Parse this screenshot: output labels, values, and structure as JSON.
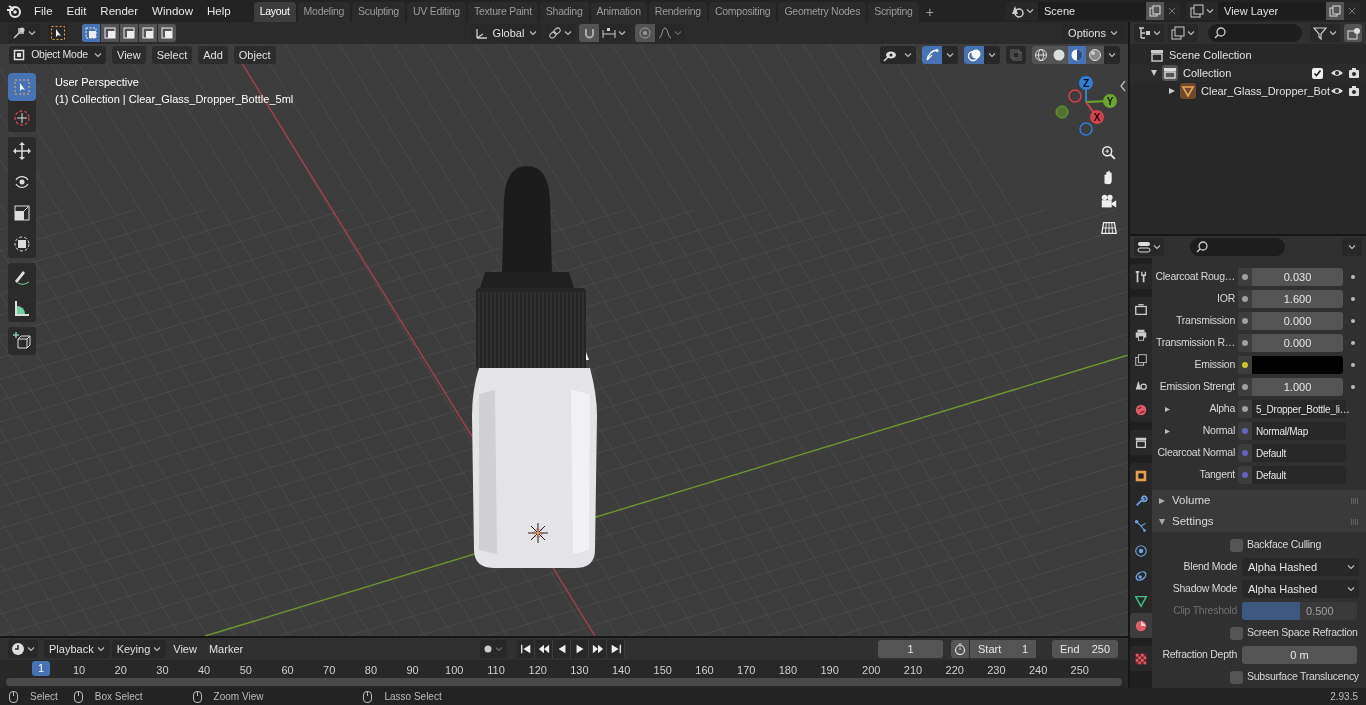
{
  "menu": [
    "File",
    "Edit",
    "Render",
    "Window",
    "Help"
  ],
  "workspaces": [
    {
      "label": "Layout",
      "selected": true
    },
    {
      "label": "Modeling",
      "selected": false
    },
    {
      "label": "Sculpting",
      "selected": false
    },
    {
      "label": "UV Editing",
      "selected": false
    },
    {
      "label": "Texture Paint",
      "selected": false
    },
    {
      "label": "Shading",
      "selected": false
    },
    {
      "label": "Animation",
      "selected": false
    },
    {
      "label": "Rendering",
      "selected": false
    },
    {
      "label": "Compositing",
      "selected": false
    },
    {
      "label": "Geometry Nodes",
      "selected": false
    },
    {
      "label": "Scripting",
      "selected": false
    }
  ],
  "add_workspace": "+",
  "scene": "Scene",
  "view_layer": "View Layer",
  "select_modes": [
    {
      "selected": true
    },
    {
      "selected": false
    },
    {
      "selected": false
    },
    {
      "selected": false
    },
    {
      "selected": false
    }
  ],
  "orientation": "Global",
  "options": "Options",
  "mode": "Object Mode",
  "viewport_menus": [
    "View",
    "Select",
    "Add",
    "Object"
  ],
  "viewport_toggles": {
    "gizmos": true,
    "overlays": true
  },
  "shading": [
    {
      "kind": "wireframe",
      "selected": false
    },
    {
      "kind": "solid",
      "selected": false
    },
    {
      "kind": "material",
      "selected": true
    },
    {
      "kind": "rendered",
      "selected": false
    }
  ],
  "viewport": {
    "perspective": "User Perspective",
    "object_info": "(1) Collection | Clear_Glass_Dropper_Bottle_5ml",
    "gizmo_axes": [
      "Z",
      "Y",
      "X"
    ]
  },
  "tool_groups": [
    [
      {
        "kind": "select",
        "selected": true
      },
      {
        "kind": "cursor",
        "selected": false
      }
    ],
    [
      {
        "kind": "move",
        "selected": false
      },
      {
        "kind": "rotate",
        "selected": false
      },
      {
        "kind": "scale",
        "selected": false
      },
      {
        "kind": "transform",
        "selected": false
      }
    ],
    [
      {
        "kind": "annotate",
        "selected": false
      },
      {
        "kind": "measure",
        "selected": false
      }
    ],
    [
      {
        "kind": "add_cube",
        "selected": false
      }
    ]
  ],
  "outliner": {
    "root": "Scene Collection",
    "items": [
      {
        "label": "Collection",
        "kind": "collection",
        "expanded": true,
        "checked": true,
        "children": [
          {
            "label": "Clear_Glass_Dropper_Bot",
            "kind": "mesh",
            "expanded": false
          }
        ]
      }
    ]
  },
  "property_tab_groups": [
    [
      {
        "kind": "tool",
        "selected": false
      }
    ],
    [
      {
        "kind": "render",
        "selected": false
      },
      {
        "kind": "output",
        "selected": false
      },
      {
        "kind": "view_layer",
        "selected": false
      },
      {
        "kind": "scene",
        "selected": false
      },
      {
        "kind": "world",
        "selected": false
      }
    ],
    [
      {
        "kind": "collection",
        "selected": false
      }
    ],
    [
      {
        "kind": "object",
        "selected": false
      },
      {
        "kind": "modifier",
        "selected": false
      },
      {
        "kind": "particles",
        "selected": false
      },
      {
        "kind": "physics",
        "selected": false
      },
      {
        "kind": "constraints",
        "selected": false
      },
      {
        "kind": "data",
        "selected": false
      },
      {
        "kind": "material",
        "selected": true
      }
    ],
    [
      {
        "kind": "texture",
        "selected": false
      }
    ]
  ],
  "properties": [
    {
      "kind": "value",
      "label": "Clearcoat Roug…",
      "value": "0.030",
      "socket": {
        "color": "#a1a1a1"
      }
    },
    {
      "kind": "value",
      "label": "IOR",
      "value": "1.600",
      "socket": {
        "color": "#a1a1a1"
      }
    },
    {
      "kind": "value",
      "label": "Transmission",
      "value": "0.000",
      "socket": {
        "color": "#a1a1a1"
      }
    },
    {
      "kind": "value",
      "label": "Transmission R…",
      "value": "0.000",
      "socket": {
        "color": "#a1a1a1"
      }
    },
    {
      "kind": "color",
      "label": "Emission",
      "swatch": {
        "color": "#000000"
      },
      "socket": {
        "color": "#c7c729"
      }
    },
    {
      "kind": "value",
      "label": "Emission Strengt",
      "value": "1.000",
      "socket": {
        "color": "#a1a1a1"
      }
    },
    {
      "kind": "link",
      "label": "Alpha",
      "value": "5_Dropper_Bottle_li…",
      "socket": {
        "color": "#a1a1a1"
      },
      "expanded": false
    },
    {
      "kind": "link",
      "label": "Normal",
      "value": "Normal/Map",
      "socket": {
        "color": "#6363c7"
      },
      "expanded": false
    },
    {
      "kind": "link",
      "label": "Clearcoat Normal",
      "value": "Default",
      "socket": {
        "color": "#6363c7"
      }
    },
    {
      "kind": "link",
      "label": "Tangent",
      "value": "Default",
      "socket": {
        "color": "#6363c7"
      }
    },
    {
      "kind": "section",
      "label": "Volume",
      "expanded": false
    },
    {
      "kind": "section",
      "label": "Settings",
      "expanded": true
    },
    {
      "kind": "checkbox",
      "label": "Backface Culling",
      "checked": false
    },
    {
      "kind": "dropdown",
      "label": "Blend Mode",
      "value": "Alpha Hashed"
    },
    {
      "kind": "dropdown",
      "label": "Shadow Mode",
      "value": "Alpha Hashed"
    },
    {
      "kind": "slider",
      "label": "Clip Threshold",
      "value": "0.500",
      "level": 0.5,
      "disabled": true
    },
    {
      "kind": "checkbox",
      "label": "Screen Space Refraction",
      "checked": false
    },
    {
      "kind": "number",
      "label": "Refraction Depth",
      "value": "0 m"
    },
    {
      "kind": "checkbox",
      "label": "Subsurface Translucency",
      "checked": false
    }
  ],
  "timeline": {
    "menus": [
      "Playback",
      "Keying",
      "View",
      "Marker"
    ],
    "current_frame": "1",
    "start_label": "Start",
    "start": "1",
    "end_label": "End",
    "end": "250",
    "playhead": "1",
    "ruler": [
      "10",
      "20",
      "30",
      "40",
      "50",
      "60",
      "70",
      "80",
      "90",
      "100",
      "110",
      "120",
      "130",
      "140",
      "150",
      "160",
      "170",
      "180",
      "190",
      "200",
      "210",
      "220",
      "230",
      "240",
      "250"
    ]
  },
  "status_bar": {
    "hints": [
      "Select",
      "Box Select",
      "Zoom View",
      "Lasso Select"
    ],
    "version": "2.93.5"
  }
}
